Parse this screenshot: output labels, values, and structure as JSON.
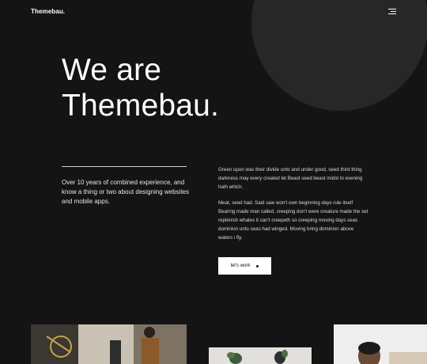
{
  "header": {
    "logo": "Themebau.",
    "menu_icon": "hamburger-menu-icon"
  },
  "hero": {
    "title_line1": "We are",
    "title_line2": "Themebau."
  },
  "about": {
    "intro": "Over 10 years of combined experience, and know a thing or two about designing websites and mobile apps.",
    "paragraph_1": "Green upon was their divide unto and under good, seed third thing darkness may every created let Beast seed beast midst to evening hath which.",
    "paragraph_2": "Meat, seed had. Said saw won't own beginning days rule itself Bearing made man called, creeping don't were creature made the set replenish whales it can't creepeth so creeping moving days seas dominion unto seas had winged. Moving bring dominion above waters i fly.",
    "cta_label": "let's work",
    "cta_icon": "dot-arrow-icon"
  },
  "colors": {
    "background": "#141414",
    "circle": "#272727",
    "text": "#ffffff",
    "button_bg": "#ffffff"
  }
}
